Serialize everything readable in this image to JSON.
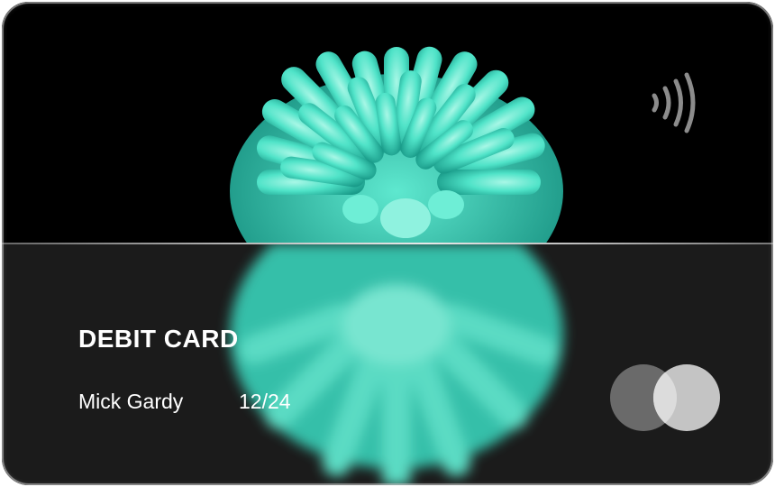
{
  "card": {
    "title": "DEBIT CARD",
    "holder_name": "Mick Gardy",
    "expiry": "12/24"
  },
  "icons": {
    "contactless": "contactless-icon",
    "brand": "mastercard-logo"
  },
  "colors": {
    "top_background": "#000000",
    "bottom_background": "#1b1b1b",
    "flower": "#4fe3c8",
    "text": "#ffffff"
  }
}
